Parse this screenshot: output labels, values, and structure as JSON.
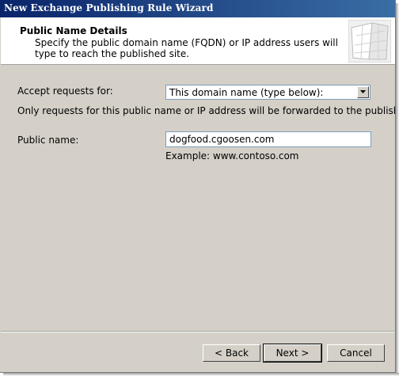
{
  "window": {
    "title": "New Exchange Publishing Rule Wizard"
  },
  "header": {
    "title": "Public Name Details",
    "description": "Specify the public domain name (FQDN) or IP address users will type to reach the published site."
  },
  "form": {
    "accept_label": "Accept requests for:",
    "accept_value": "This domain name (type below):",
    "note": "Only requests for this public name or IP address will be forwarded to the published site.",
    "public_name_label": "Public name:",
    "public_name_value": "dogfood.cgoosen.com",
    "example": "Example: www.contoso.com"
  },
  "buttons": {
    "back": "< Back",
    "next": "Next >",
    "cancel": "Cancel"
  }
}
